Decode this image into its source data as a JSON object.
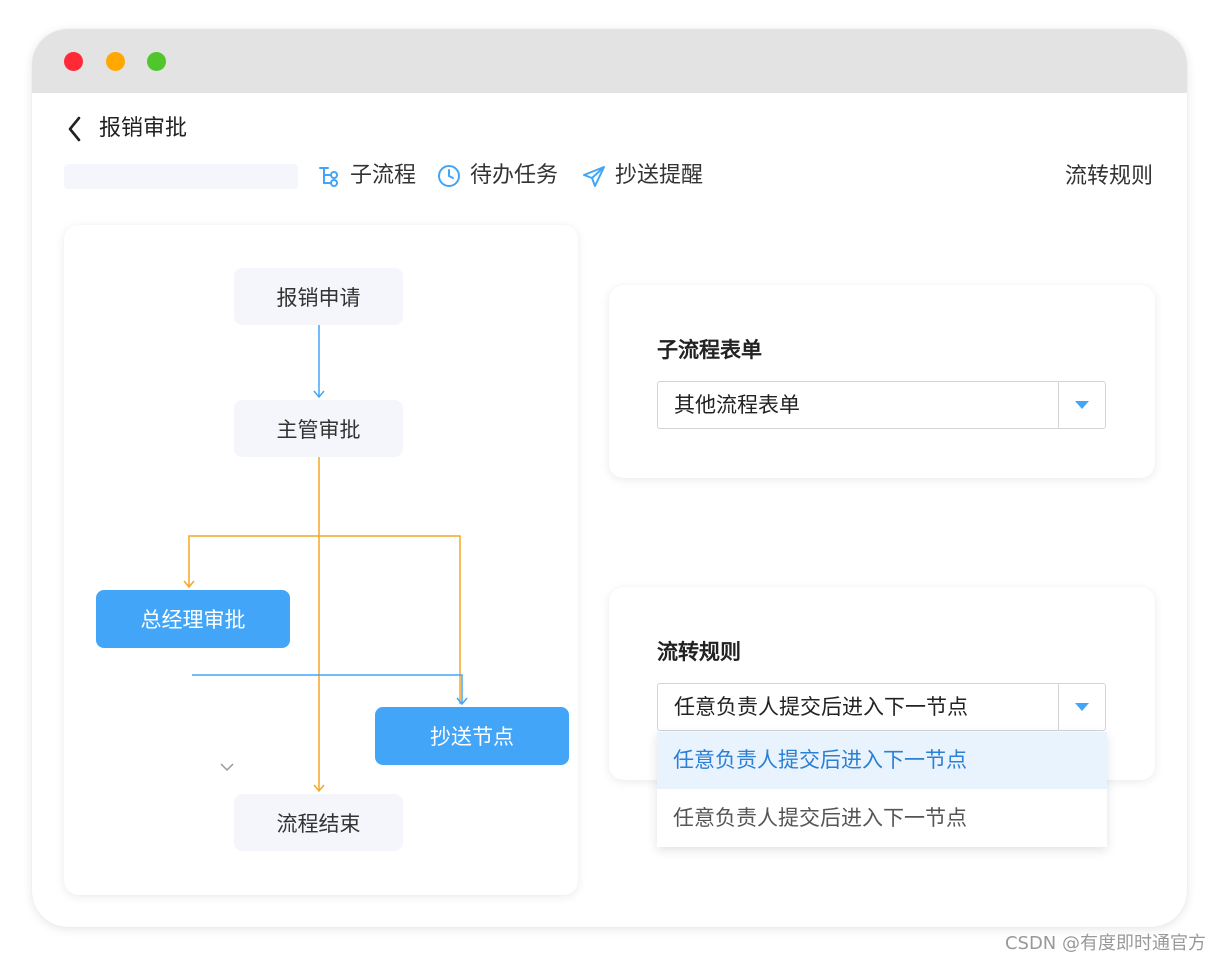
{
  "page": {
    "title": "报销审批"
  },
  "toolbar": {
    "sub_process": "子流程",
    "todo_tasks": "待办任务",
    "cc_reminder": "抄送提醒",
    "flow_rules": "流转规则"
  },
  "flow": {
    "nodes": {
      "apply": "报销申请",
      "manager": "主管审批",
      "general_manager": "总经理审批",
      "cc_node": "抄送节点",
      "end": "流程结束"
    }
  },
  "sub_form_card": {
    "label": "子流程表单",
    "select_value": "其他流程表单"
  },
  "rule_card": {
    "label": "流转规则",
    "select_value": "任意负责人提交后进入下一节点",
    "options": [
      "任意负责人提交后进入下一节点",
      "任意负责人提交后进入下一节点"
    ]
  },
  "colors": {
    "accent_blue": "#42a5f8",
    "connector_orange": "#f5a623",
    "connector_blue": "#42a5f8",
    "node_light": "#f4f6fc"
  },
  "watermark": "CSDN @有度即时通官方"
}
